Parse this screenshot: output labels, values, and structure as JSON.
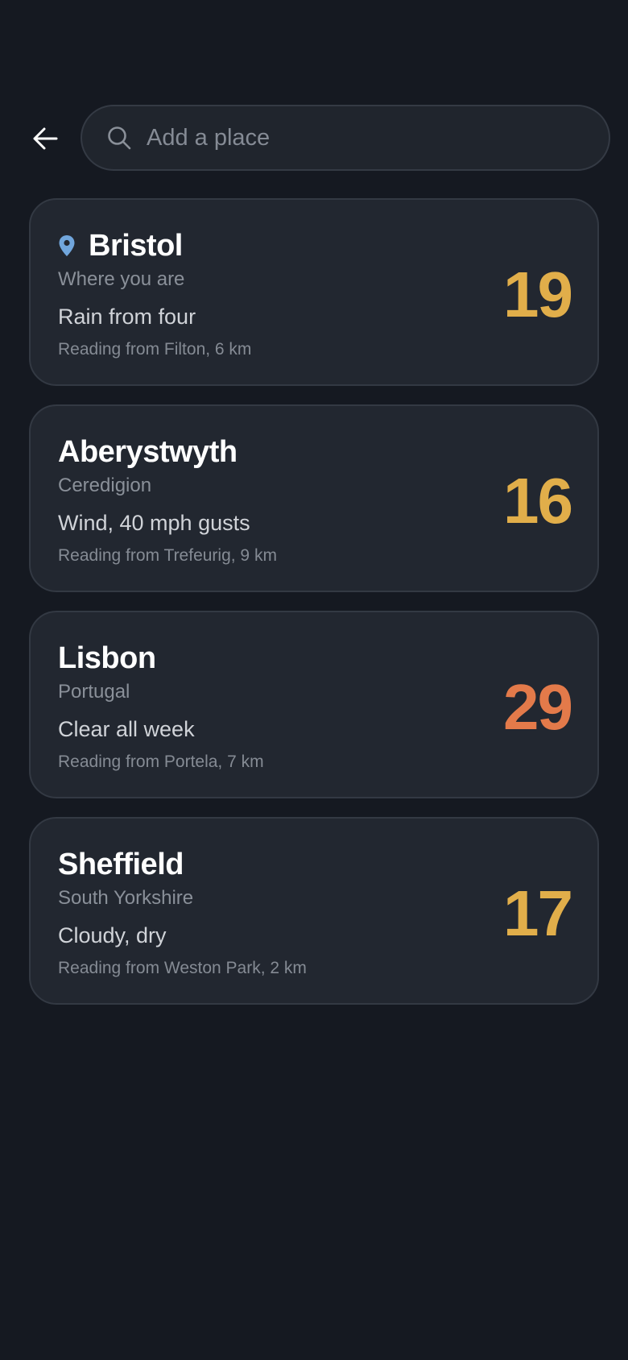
{
  "colors": {
    "background": "#151921",
    "card_background": "#222730",
    "card_border": "#333943",
    "warm_temp": "#e1ae4a",
    "hot_temp": "#e37a4a",
    "location_pin": "#71a6dc"
  },
  "header": {
    "back_icon": "arrow-left-icon",
    "search": {
      "icon": "search-icon",
      "placeholder": "Add a place",
      "value": ""
    }
  },
  "places": [
    {
      "name": "Bristol",
      "is_current_location": true,
      "icon": "location-pin-icon",
      "region": "Where you are",
      "condition": "Rain from four",
      "source": "Reading from Filton, 6 km",
      "temperature": "19",
      "temp_color": "#e1ae4a"
    },
    {
      "name": "Aberystwyth",
      "is_current_location": false,
      "region": "Ceredigion",
      "condition": "Wind, 40 mph gusts",
      "source": "Reading from Trefeurig, 9 km",
      "temperature": "16",
      "temp_color": "#e1ae4a"
    },
    {
      "name": "Lisbon",
      "is_current_location": false,
      "region": "Portugal",
      "condition": "Clear all week",
      "source": "Reading from Portela, 7 km",
      "temperature": "29",
      "temp_color": "#e37a4a"
    },
    {
      "name": "Sheffield",
      "is_current_location": false,
      "region": "South Yorkshire",
      "condition": "Cloudy, dry",
      "source": "Reading from Weston Park, 2 km",
      "temperature": "17",
      "temp_color": "#e1ae4a"
    }
  ]
}
